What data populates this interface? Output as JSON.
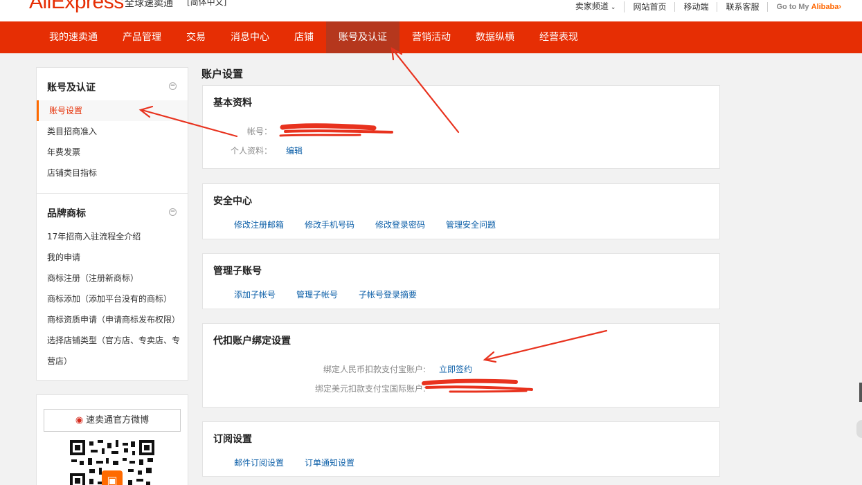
{
  "header": {
    "logo": "AliExpress",
    "logo_cn": "全球速卖通",
    "lang": "[简体中文] ˅",
    "links": [
      "卖家频道",
      "网站首页",
      "移动端",
      "联系客服"
    ],
    "goto_prefix": "Go to My ",
    "goto_brand": "Alibaba",
    "goto_arrow": "›"
  },
  "nav": {
    "items": [
      "我的速卖通",
      "产品管理",
      "交易",
      "消息中心",
      "店铺",
      "账号及认证",
      "营销活动",
      "数据纵横",
      "经营表现"
    ],
    "active": "账号及认证"
  },
  "sidebar": {
    "group1": {
      "title": "账号及认证",
      "items": [
        "账号设置",
        "类目招商准入",
        "年费发票",
        "店铺类目指标"
      ]
    },
    "group2": {
      "title": "品牌商标",
      "items": [
        "17年招商入驻流程全介绍",
        "我的申请",
        "商标注册（注册新商标）",
        "商标添加（添加平台没有的商标）",
        "商标资质申请（申请商标发布权限）",
        "选择店铺类型（官方店、专卖店、专营店）"
      ]
    },
    "weibo": "速卖通官方微博"
  },
  "main": {
    "title": "账户设置",
    "basic": {
      "title": "基本资料",
      "account_label": "帐号：",
      "profile_label": "个人资料：",
      "edit": "编辑"
    },
    "security": {
      "title": "安全中心",
      "links": [
        "修改注册邮箱",
        "修改手机号码",
        "修改登录密码",
        "管理安全问题"
      ]
    },
    "sub": {
      "title": "管理子账号",
      "links": [
        "添加子帐号",
        "管理子帐号",
        "子帐号登录摘要"
      ]
    },
    "bind": {
      "title": "代扣账户绑定设置",
      "rmb_label": "绑定人民币扣款支付宝账户:",
      "rmb_action": "立即签约",
      "usd_label": "绑定美元扣款支付宝国际账户:"
    },
    "subscribe": {
      "title": "订阅设置",
      "links": [
        "邮件订阅设置",
        "订单通知设置"
      ]
    }
  },
  "colors": {
    "brand": "#e62e04",
    "active_nav": "#b5371d",
    "link": "#0c5fa8",
    "annotation": "#e8321e"
  }
}
